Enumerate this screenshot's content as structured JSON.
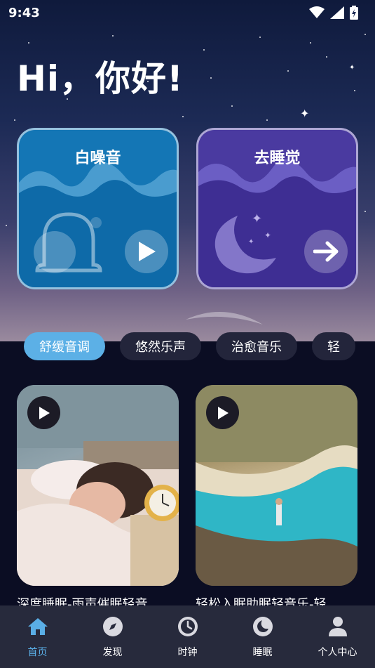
{
  "status_bar": {
    "time": "9:43",
    "icons": [
      "wifi-icon",
      "signal-icon",
      "battery-charging-icon"
    ]
  },
  "greeting": "Hi，你好!",
  "feature_cards": [
    {
      "title": "白噪音",
      "icon": "bell-icon",
      "action": "play-icon",
      "color": "#1476b5"
    },
    {
      "title": "去睡觉",
      "icon": "moon-icon",
      "action": "arrow-right-icon",
      "color": "#4a3aa0"
    }
  ],
  "tabs": [
    {
      "label": "舒缓音调",
      "active": true
    },
    {
      "label": "悠然乐声",
      "active": false
    },
    {
      "label": "治愈音乐",
      "active": false
    },
    {
      "label": "轻",
      "active": false
    }
  ],
  "media": [
    {
      "title": "深度睡眠-雨声催眠轻音",
      "icon": "play-icon"
    },
    {
      "title": "轻松入眠助眠轻音乐-轻",
      "icon": "play-icon"
    }
  ],
  "bottom_nav": [
    {
      "label": "首页",
      "icon": "home-icon",
      "active": true
    },
    {
      "label": "发现",
      "icon": "compass-icon",
      "active": false
    },
    {
      "label": "时钟",
      "icon": "clock-icon",
      "active": false
    },
    {
      "label": "睡眠",
      "icon": "moon-icon",
      "active": false
    },
    {
      "label": "个人中心",
      "icon": "user-icon",
      "active": false
    }
  ],
  "accent_color": "#5cb0e6"
}
